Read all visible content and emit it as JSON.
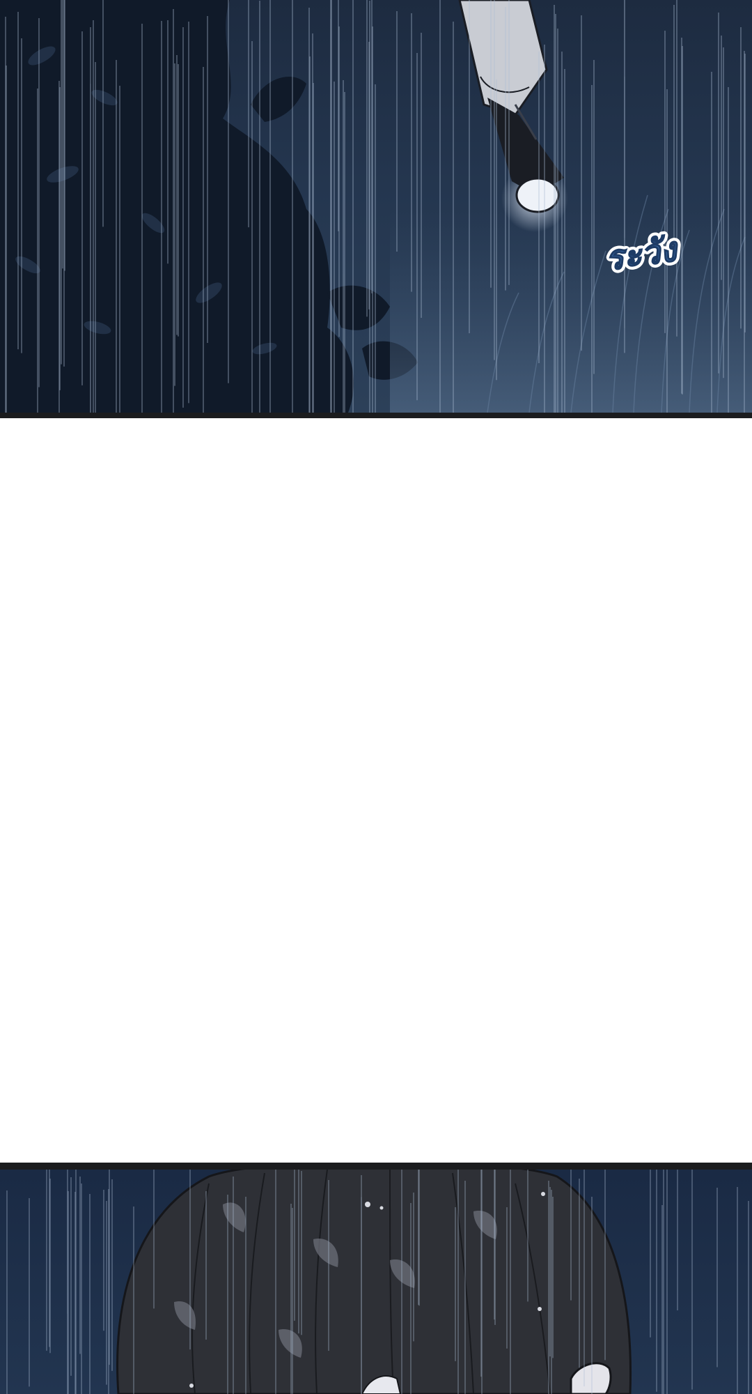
{
  "comic": {
    "panels": [
      {
        "sfx": "ระวัง",
        "sfx_fill": "#3a6aa8",
        "sfx_stroke": "#ffffff"
      },
      {},
      {}
    ]
  },
  "colors": {
    "night_sky": "#1d2b40",
    "rain": "#aebfd6",
    "foliage": "#0f1826",
    "hair": "#2e3036",
    "hair_highlight": "#6c6f79",
    "sleeve": "#c9ccd3",
    "divider": "#1b1c1e"
  }
}
